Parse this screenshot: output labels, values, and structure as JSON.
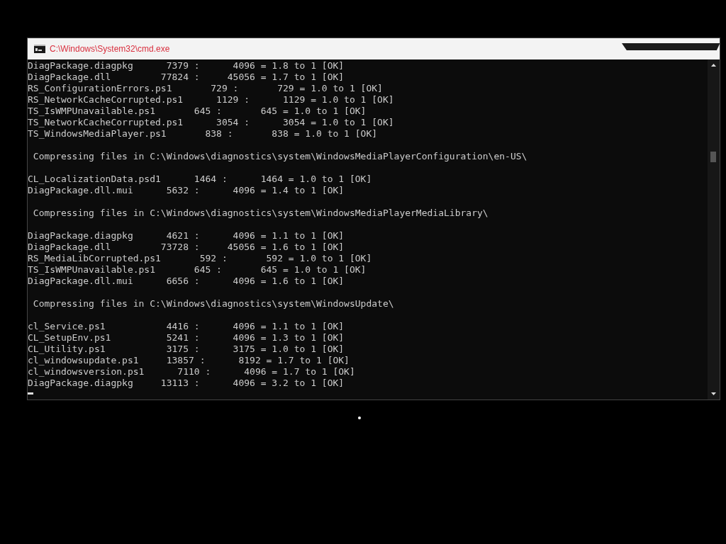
{
  "window": {
    "title": "C:\\Windows\\System32\\cmd.exe"
  },
  "console": {
    "sections": [
      {
        "files": [
          "DiagPackage.diagpkg      7379 :      4096 = 1.8 to 1 [OK]",
          "DiagPackage.dll         77824 :     45056 = 1.7 to 1 [OK]",
          "RS_ConfigurationErrors.ps1       729 :       729 = 1.0 to 1 [OK]",
          "RS_NetworkCacheCorrupted.ps1      1129 :      1129 = 1.0 to 1 [OK]",
          "TS_IsWMPUnavailable.ps1       645 :       645 = 1.0 to 1 [OK]",
          "TS_NetworkCacheCorrupted.ps1      3054 :      3054 = 1.0 to 1 [OK]",
          "TS_WindowsMediaPlayer.ps1       838 :       838 = 1.0 to 1 [OK]"
        ]
      },
      {
        "heading": " Compressing files in C:\\Windows\\diagnostics\\system\\WindowsMediaPlayerConfiguration\\en-US\\",
        "files": [
          "CL_LocalizationData.psd1      1464 :      1464 = 1.0 to 1 [OK]",
          "DiagPackage.dll.mui      5632 :      4096 = 1.4 to 1 [OK]"
        ]
      },
      {
        "heading": " Compressing files in C:\\Windows\\diagnostics\\system\\WindowsMediaPlayerMediaLibrary\\",
        "files": [
          "DiagPackage.diagpkg      4621 :      4096 = 1.1 to 1 [OK]",
          "DiagPackage.dll         73728 :     45056 = 1.6 to 1 [OK]",
          "RS_MediaLibCorrupted.ps1       592 :       592 = 1.0 to 1 [OK]",
          "TS_IsWMPUnavailable.ps1       645 :       645 = 1.0 to 1 [OK]",
          "DiagPackage.dll.mui      6656 :      4096 = 1.6 to 1 [OK]"
        ]
      },
      {
        "heading": " Compressing files in C:\\Windows\\diagnostics\\system\\WindowsUpdate\\",
        "files": [
          "cl_Service.ps1           4416 :      4096 = 1.1 to 1 [OK]",
          "CL_SetupEnv.ps1          5241 :      4096 = 1.3 to 1 [OK]",
          "CL_Utility.ps1           3175 :      3175 = 1.0 to 1 [OK]",
          "cl_windowsupdate.ps1     13857 :      8192 = 1.7 to 1 [OK]",
          "cl_windowsversion.ps1      7110 :      4096 = 1.7 to 1 [OK]",
          "DiagPackage.diagpkg     13113 :      4096 = 3.2 to 1 [OK]"
        ]
      }
    ]
  }
}
